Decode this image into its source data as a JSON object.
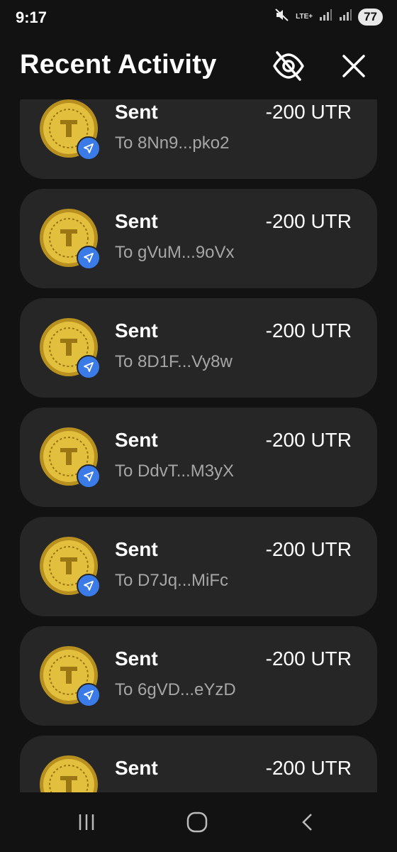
{
  "status_bar": {
    "time": "9:17",
    "network": "LTE+",
    "battery": "77",
    "icons": [
      "mute-icon",
      "signal-icon",
      "signal-icon",
      "battery-icon"
    ]
  },
  "header": {
    "title": "Recent Activity",
    "hide_icon": "eye-off-icon",
    "close_icon": "close-icon"
  },
  "activity": [
    {
      "title": "Sent",
      "amount": "-200 UTR",
      "address": "To 8Nn9...pko2"
    },
    {
      "title": "Sent",
      "amount": "-200 UTR",
      "address": "To gVuM...9oVx"
    },
    {
      "title": "Sent",
      "amount": "-200 UTR",
      "address": "To 8D1F...Vy8w"
    },
    {
      "title": "Sent",
      "amount": "-200 UTR",
      "address": "To DdvT...M3yX"
    },
    {
      "title": "Sent",
      "amount": "-200 UTR",
      "address": "To D7Jq...MiFc"
    },
    {
      "title": "Sent",
      "amount": "-200 UTR",
      "address": "To 6gVD...eYzD"
    },
    {
      "title": "Sent",
      "amount": "-200 UTR",
      "address": ""
    }
  ],
  "colors": {
    "background": "#121212",
    "card": "#262626",
    "badge": "#3b7be8",
    "coin": "#d4af37",
    "secondary_text": "#a6a6a6"
  },
  "nav": {
    "icons": [
      "recent-apps-icon",
      "home-icon",
      "back-icon"
    ]
  }
}
